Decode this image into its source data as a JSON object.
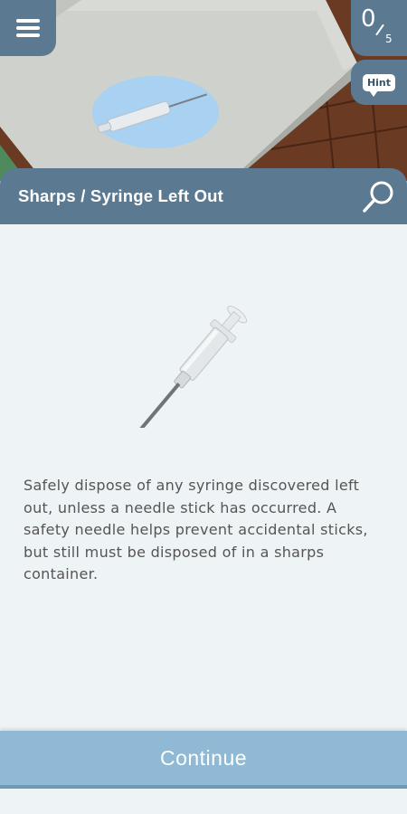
{
  "scene": {
    "colors": {
      "wall": "#6a3a22",
      "counter": "#cfd2cc",
      "floor": "#4f8a5c",
      "highlight": "#a8d1f2"
    }
  },
  "header": {
    "menu_icon": "hamburger-icon",
    "score": {
      "found": "0",
      "total": "5"
    },
    "hint_label": "Hint"
  },
  "panel": {
    "title": "Sharps / Syringe Left Out",
    "search_icon": "magnifier-icon",
    "description": "Safely dispose of any syringe discovered left out, unless a needle stick has occurred. A safety needle helps prevent accidental sticks, but still must be disposed of in a sharps container.",
    "continue_label": "Continue"
  },
  "colors": {
    "accent": "#5b7a92",
    "button": "#8fb9d5",
    "body_bg": "#eef3f5"
  }
}
